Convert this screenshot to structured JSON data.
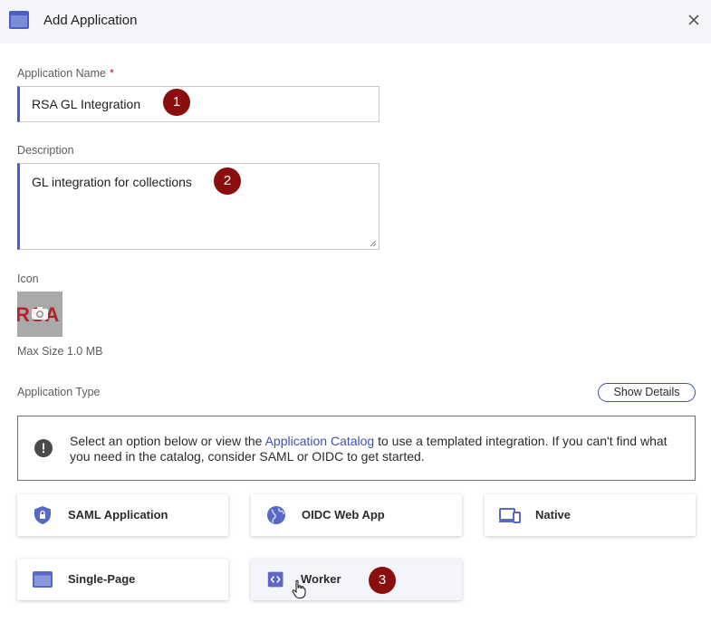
{
  "header": {
    "title": "Add Application",
    "app_icon": "window-icon",
    "close_icon": "close-icon"
  },
  "form": {
    "app_name": {
      "label": "Application Name",
      "required_marker": "*",
      "value": "RSA GL Integration",
      "marker": "1"
    },
    "description": {
      "label": "Description",
      "value": "GL integration for collections",
      "marker": "2"
    },
    "icon": {
      "label": "Icon",
      "logo_text": "RSA",
      "max_size": "Max Size 1.0 MB"
    },
    "app_type": {
      "label": "Application Type",
      "show_details": "Show Details",
      "info_before": "Select an option below or view the ",
      "info_link": "Application Catalog",
      "info_after": " to use a templated integration. If you can't find what you need in the catalog, consider SAML or OIDC to get started."
    }
  },
  "types": [
    {
      "label": "SAML Application",
      "icon": "shield-lock-icon"
    },
    {
      "label": "OIDC Web App",
      "icon": "globe-icon"
    },
    {
      "label": "Native",
      "icon": "devices-icon"
    },
    {
      "label": "Single-Page",
      "icon": "window-icon"
    },
    {
      "label": "Worker",
      "icon": "code-icon",
      "marker": "3"
    }
  ],
  "colors": {
    "accent": "#4a5fc1",
    "badge": "#8b0e0e",
    "required": "#c8102e",
    "header_bg": "#f4f5f9"
  }
}
